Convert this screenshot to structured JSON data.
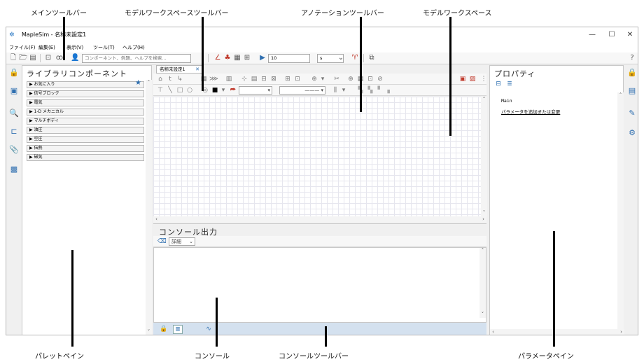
{
  "callouts": {
    "main_toolbar": "メインツールバー",
    "model_ws_toolbar": "モデルワークスペースツールバー",
    "annotation_toolbar": "アノテーションツールバー",
    "model_workspace": "モデルワークスペース",
    "palette_pane": "パレットペイン",
    "console": "コンソール",
    "console_toolbar": "コンソールツールバー",
    "parameter_pane": "パラメータペイン"
  },
  "window": {
    "title": "MapleSim - 名称未設定1",
    "minimize": "—",
    "maximize": "☐",
    "close": "✕"
  },
  "menu": [
    "ファイル(F)",
    "編集(E)",
    "表示(V)",
    "ツール(T)",
    "ヘルプ(H)"
  ],
  "main_toolbar": {
    "search_placeholder": "コンポーネント、例題、ヘルプを検索...",
    "sim_time": "10",
    "time_unit": "s",
    "help_icon": "?"
  },
  "palette": {
    "title": "ライブラリコンポーネント",
    "categories": [
      "▶ お気に入り",
      "▶ 信号ブロック",
      "▶ 電気",
      "▶ 1-D メカニカル",
      "▶ マルチボディ",
      "▶ 油圧",
      "▶ 空圧",
      "▶ 伝熱",
      "▶ 磁気"
    ],
    "favorite_star": "★"
  },
  "workspace": {
    "tab_label": "名称未設定1",
    "tab_close": "✕"
  },
  "console": {
    "title": "コンソール出力",
    "detail_label": "詳細"
  },
  "params": {
    "title": "プロパティ",
    "main_label": "Main",
    "add_link": "パラメータを追加または変更"
  },
  "colors": {
    "accent_blue": "#2f6fb0",
    "console_bar": "#d4e1ef",
    "grid_line": "#e6e6ee"
  }
}
